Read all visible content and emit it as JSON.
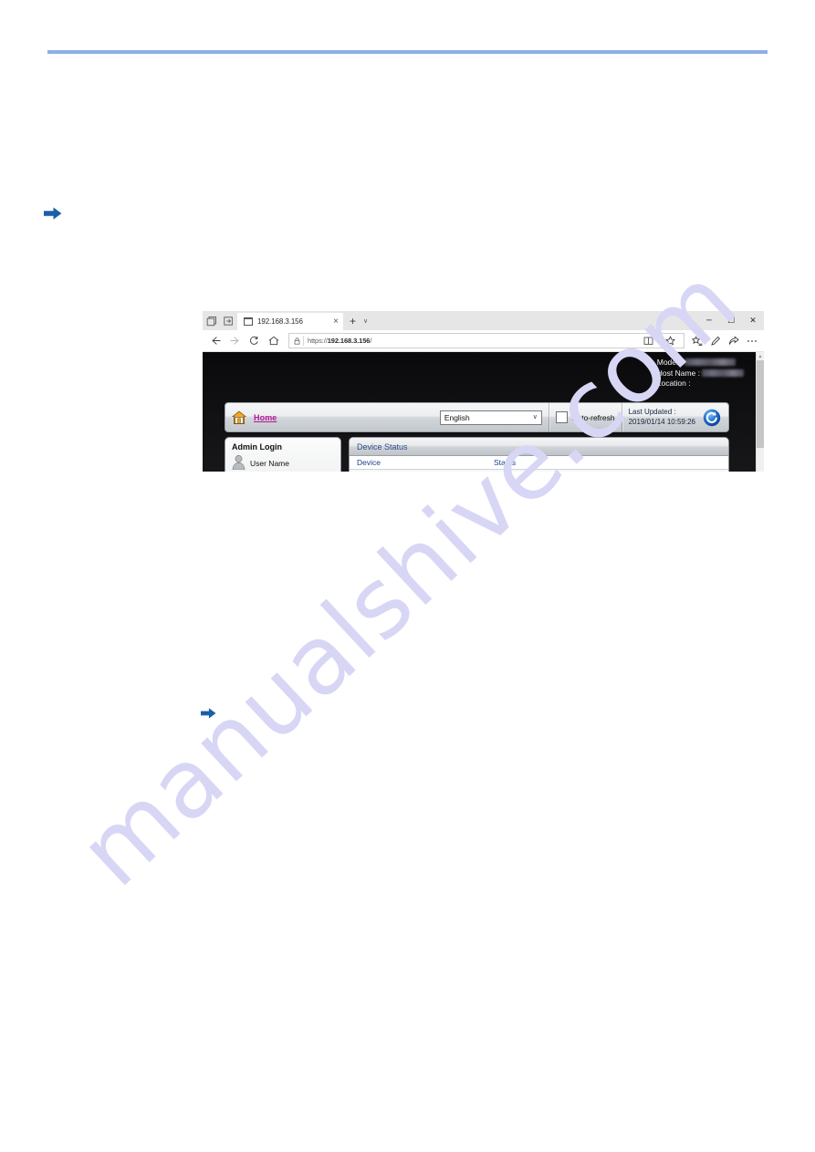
{
  "page": {
    "rule_color": "#8cb0e8",
    "watermark": "manualshive.com",
    "bullets": [
      {
        "name": "arrow-bullet-1",
        "glyph": "arrow-right"
      },
      {
        "name": "arrow-bullet-2",
        "glyph": "arrow-right"
      }
    ]
  },
  "browser": {
    "tabstrip": {
      "left_icons": [
        "tab-preview-icon",
        "set-tabs-aside-icon"
      ],
      "tab": {
        "favicon": "page-icon",
        "title": "192.168.3.156",
        "close_label": "×"
      },
      "new_tab_label": "+",
      "tab_menu_chevron": "∨",
      "window_controls": {
        "minimize": "─",
        "maximize": "☐",
        "close": "✕"
      }
    },
    "navbar": {
      "back_label": "←",
      "forward_label": "→",
      "refresh_label": "↻",
      "home_label": "⌂",
      "address": {
        "lock_icon": "lock-icon",
        "scheme": "https://",
        "host": "192.168.3.156",
        "path": "/",
        "full_url": "https://192.168.3.156/"
      },
      "right_icons": [
        "reading-view-icon",
        "favorite-star-icon",
        "hub-favorites-icon",
        "web-notes-icon",
        "share-icon",
        "more-settings-icon"
      ]
    }
  },
  "webpage": {
    "device_header": {
      "model_label": "Model :",
      "model_value": "",
      "host_label": "Host Name :",
      "host_value": "",
      "location_label": "Location :",
      "location_value": ""
    },
    "toolbar": {
      "home_icon": "home-icon",
      "home_label": "Home",
      "language_value": "English",
      "language_chevron": "∨",
      "autorefresh_label": "Auto-refresh",
      "autorefresh_checked": false,
      "last_updated_label": "Last Updated :",
      "last_updated_value": "2019/01/14 10:59:26",
      "refresh_icon": "refresh-icon"
    },
    "admin_login": {
      "title": "Admin Login",
      "avatar_icon": "user-avatar-icon",
      "username_label": "User Name",
      "username_value": ""
    },
    "device_status": {
      "title": "Device Status",
      "columns": [
        "Device",
        "Status"
      ],
      "rows": []
    }
  }
}
